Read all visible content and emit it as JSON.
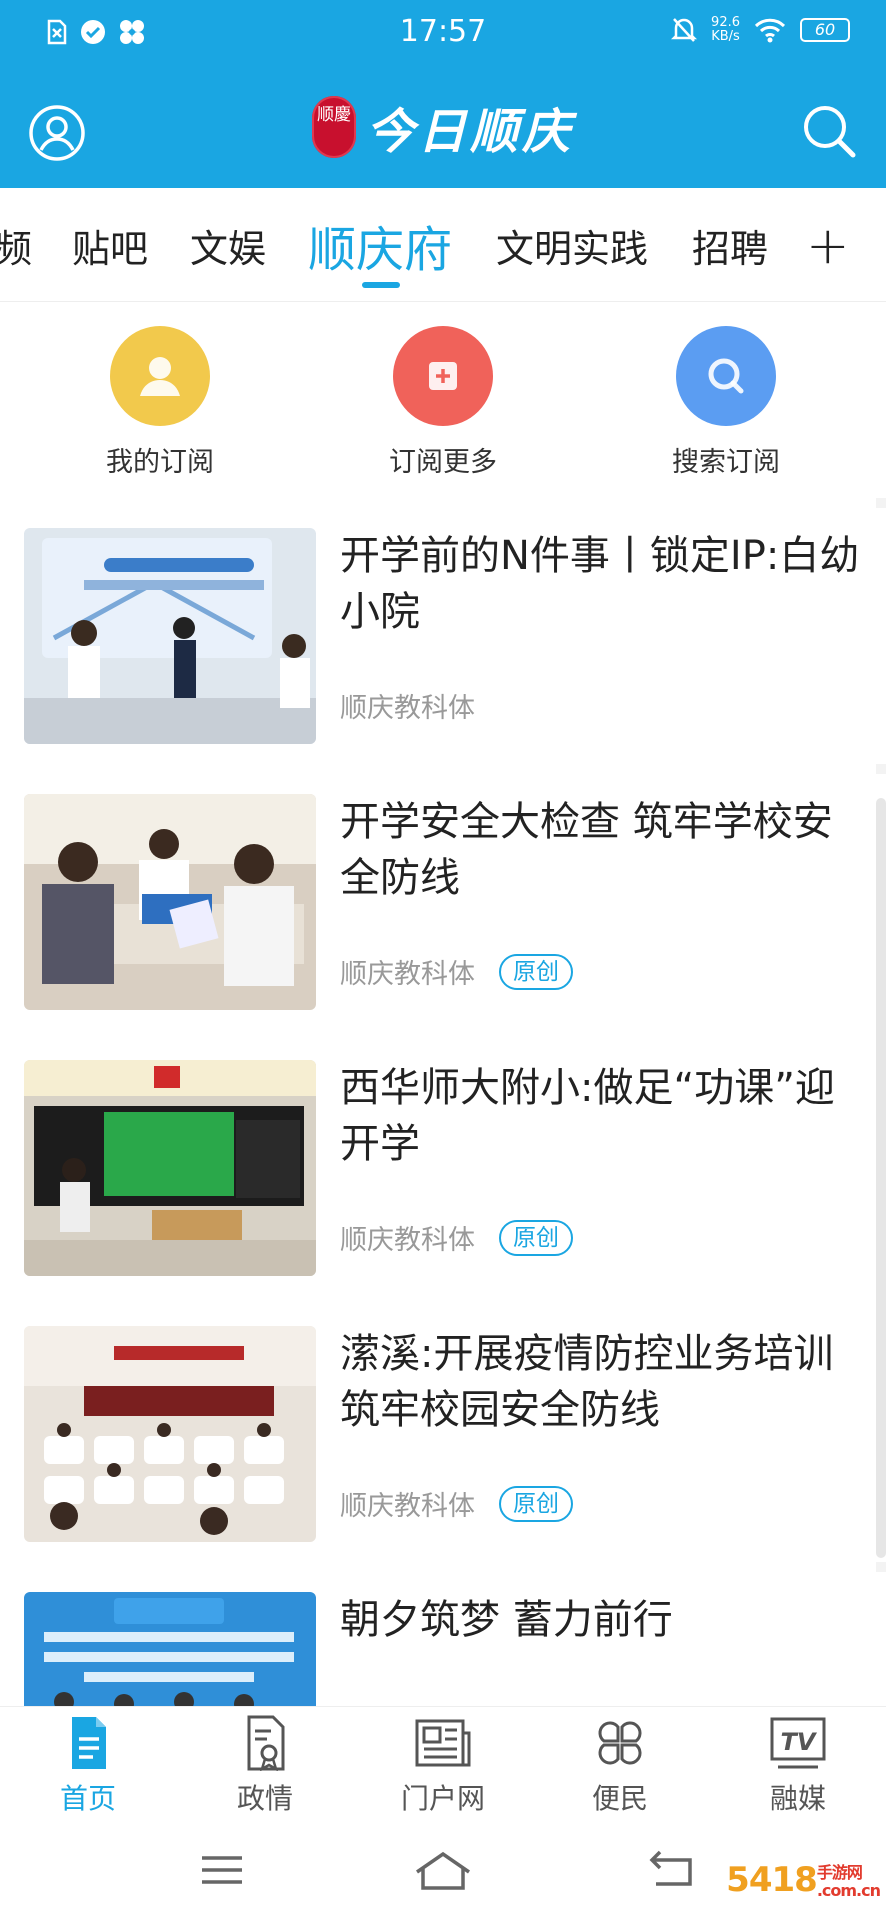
{
  "status_bar": {
    "time": "17:57",
    "network_speed": "92.6",
    "network_unit": "KB/s",
    "battery": "60"
  },
  "app_bar": {
    "logo_seal": "顺慶",
    "logo_text": "今日顺庆"
  },
  "tabs": [
    {
      "label": "频"
    },
    {
      "label": "贴吧"
    },
    {
      "label": "文娱"
    },
    {
      "label": "顺庆府",
      "active": true
    },
    {
      "label": "文明实践"
    },
    {
      "label": "招聘"
    }
  ],
  "tabs_add": "+",
  "subscriptions": [
    {
      "label": "我的订阅",
      "color": "#f2c94c",
      "icon": "person-icon"
    },
    {
      "label": "订阅更多",
      "color": "#f0625a",
      "icon": "add-icon"
    },
    {
      "label": "搜索订阅",
      "color": "#5b9df2",
      "icon": "search-icon"
    }
  ],
  "articles": [
    {
      "title": "开学前的N件事丨锁定IP:白幼小院",
      "source": "顺庆教科体",
      "badge": "",
      "thumb": "stage-drill"
    },
    {
      "title": "开学安全大检查  筑牢学校安全防线",
      "source": "顺庆教科体",
      "badge": "原创",
      "thumb": "inspection"
    },
    {
      "title": "西华师大附小:做足“功课”迎开学",
      "source": "顺庆教科体",
      "badge": "原创",
      "thumb": "classroom"
    },
    {
      "title": "潆溪:开展疫情防控业务培训  筑牢校园安全防线",
      "source": "顺庆教科体",
      "badge": "原创",
      "thumb": "meeting-hall"
    },
    {
      "title": "朝夕筑梦 蓄力前行",
      "source": "",
      "badge": "",
      "thumb": "warning-study"
    }
  ],
  "bottom_nav": [
    {
      "label": "首页",
      "active": true
    },
    {
      "label": "政情"
    },
    {
      "label": "门户网"
    },
    {
      "label": "便民"
    },
    {
      "label": "融媒"
    }
  ],
  "watermark": {
    "main": "5418",
    "small_top": "手游网",
    "small_bottom": ".com.cn"
  },
  "colors": {
    "primary": "#1aa6e2",
    "divider": "#f3f3f3"
  }
}
